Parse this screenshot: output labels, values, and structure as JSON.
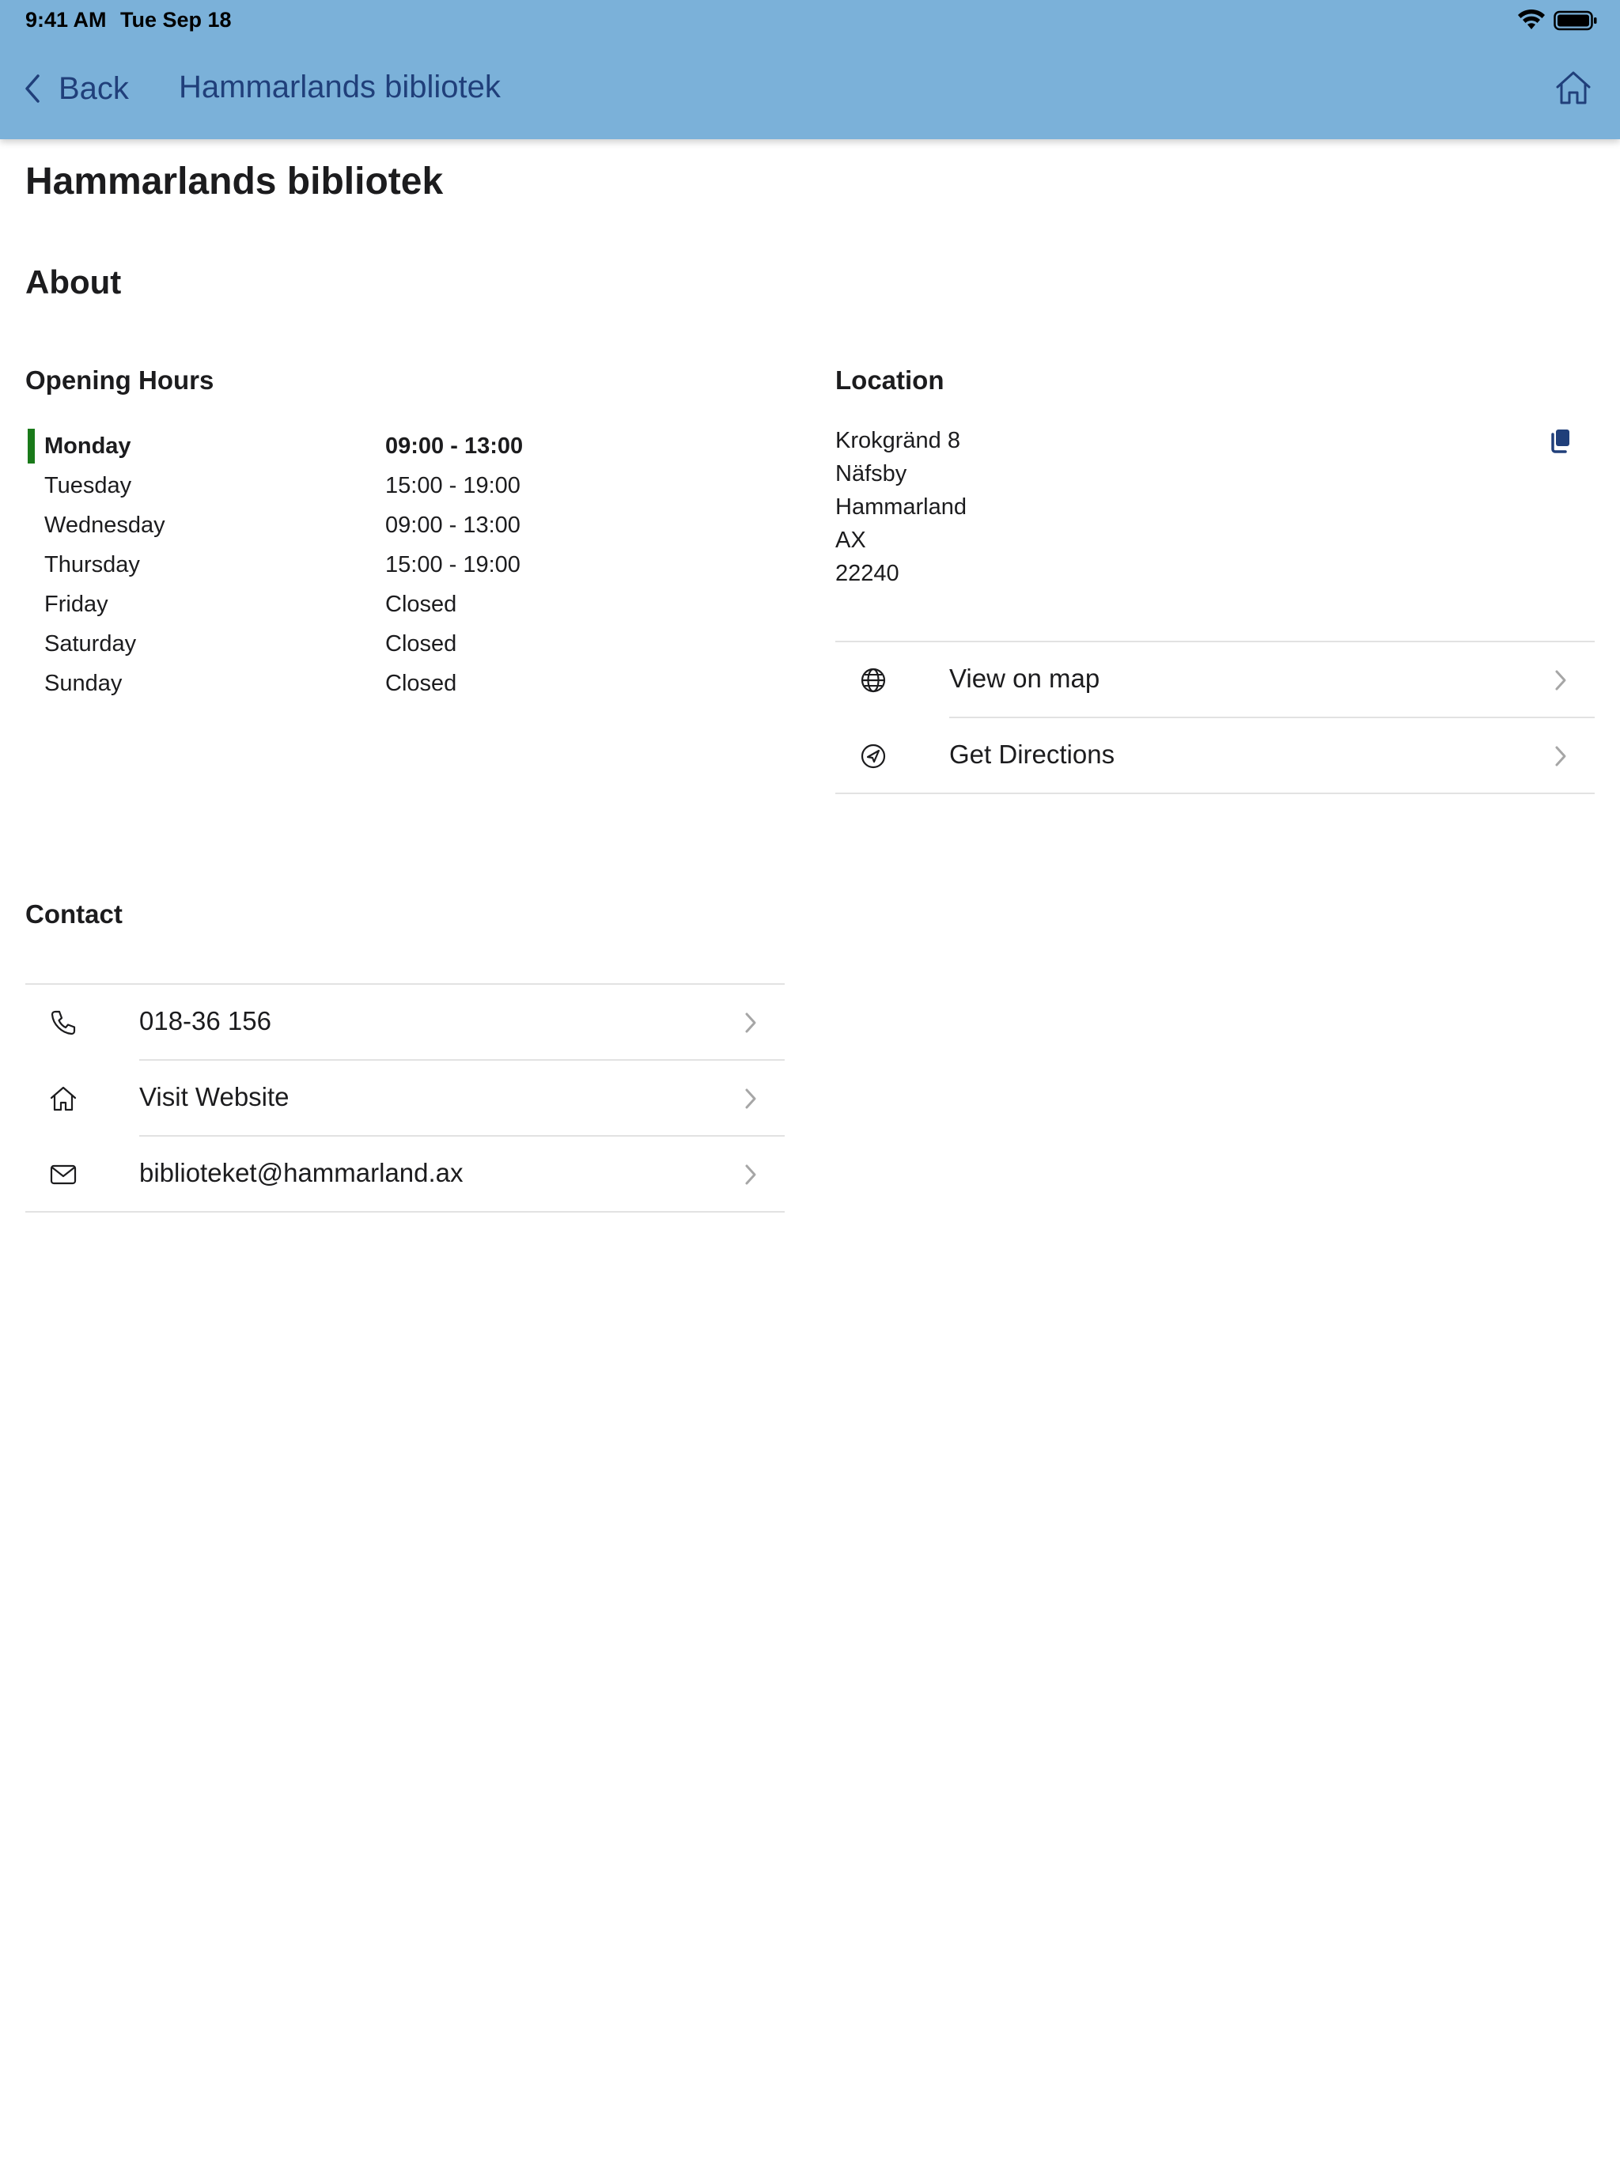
{
  "status": {
    "time": "9:41 AM",
    "date": "Tue Sep 18"
  },
  "nav": {
    "back_label": "Back",
    "title": "Hammarlands bibliotek"
  },
  "page": {
    "title": "Hammarlands bibliotek",
    "section_about": "About"
  },
  "opening_hours": {
    "heading": "Opening Hours",
    "rows": [
      {
        "day": "Monday",
        "time": "09:00 - 13:00",
        "today": true
      },
      {
        "day": "Tuesday",
        "time": "15:00 - 19:00"
      },
      {
        "day": "Wednesday",
        "time": "09:00 - 13:00"
      },
      {
        "day": "Thursday",
        "time": "15:00 - 19:00"
      },
      {
        "day": "Friday",
        "time": "Closed"
      },
      {
        "day": "Saturday",
        "time": "Closed"
      },
      {
        "day": "Sunday",
        "time": "Closed"
      }
    ]
  },
  "location": {
    "heading": "Location",
    "address_lines": [
      "Krokgränd 8",
      "Näfsby",
      "Hammarland",
      "AX",
      "22240"
    ],
    "actions": [
      {
        "label": "View on map",
        "icon": "globe-icon"
      },
      {
        "label": "Get Directions",
        "icon": "navigation-arrow-icon"
      }
    ]
  },
  "contact": {
    "heading": "Contact",
    "items": [
      {
        "label": "018-36 156",
        "icon": "phone-icon"
      },
      {
        "label": "Visit Website",
        "icon": "home-icon"
      },
      {
        "label": "biblioteket@hammarland.ax",
        "icon": "mail-icon"
      }
    ]
  },
  "colors": {
    "header": "#7bb1d9",
    "nav_text": "#203f7a",
    "today_marker": "#1a7a1a"
  }
}
